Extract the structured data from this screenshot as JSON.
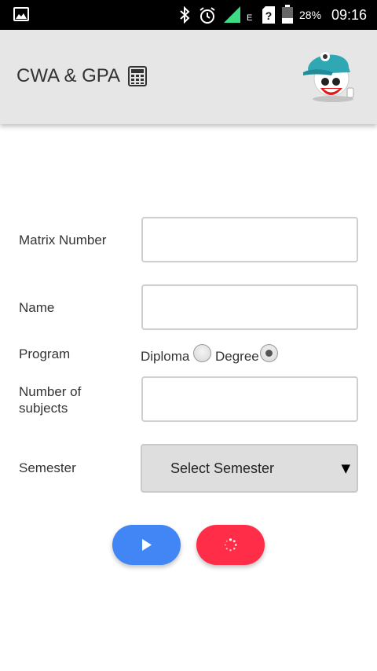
{
  "status_bar": {
    "network_type": "E",
    "battery_percent": "28%",
    "time": "09:16",
    "icons": [
      "gallery-icon",
      "bluetooth-icon",
      "alarm-icon",
      "signal-icon",
      "sim-unknown-icon",
      "battery-icon"
    ]
  },
  "app_bar": {
    "title": "CWA & GPA",
    "title_icon": "calculator-icon",
    "mascot_icon": "mascot-cap-icon"
  },
  "form": {
    "matrix_number": {
      "label": "Matrix Number",
      "value": ""
    },
    "name": {
      "label": "Name",
      "value": ""
    },
    "program": {
      "label": "Program",
      "options": [
        {
          "label": "Diploma",
          "checked": false
        },
        {
          "label": "Degree",
          "checked": true
        }
      ]
    },
    "subjects": {
      "label": "Number of subjects",
      "value": ""
    },
    "semester": {
      "label": "Semester",
      "selected": "Select Semester"
    }
  },
  "actions": {
    "run": {
      "icon": "play-icon",
      "color": "#4285f4"
    },
    "reset": {
      "icon": "loading-icon",
      "color": "#ff2d48"
    }
  }
}
